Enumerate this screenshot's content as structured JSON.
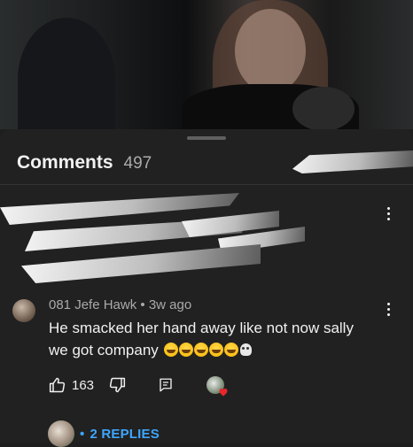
{
  "sheet": {
    "title": "Comments",
    "count": "497"
  },
  "comment": {
    "author": "081 Jefe Hawk",
    "separator": "•",
    "time": "3w ago",
    "text": "He smacked her hand away like not now sally we got company",
    "emoji_sequence": [
      "grinning-squint-emoji",
      "grinning-squint-emoji",
      "grinning-squint-emoji",
      "grinning-squint-emoji",
      "grinning-squint-emoji",
      "skull-emoji"
    ],
    "likes": "163",
    "replies_dot": "•",
    "replies_label": "2 REPLIES"
  },
  "colors": {
    "background": "#212121",
    "link_blue": "#3ea6ff",
    "secondary_text": "#aaaaaa",
    "heart_red": "#e8262b"
  },
  "icons": [
    "kebab-menu-icon",
    "thumbs-up-icon",
    "thumbs-down-icon",
    "reply-icon",
    "creator-heart-icon"
  ]
}
